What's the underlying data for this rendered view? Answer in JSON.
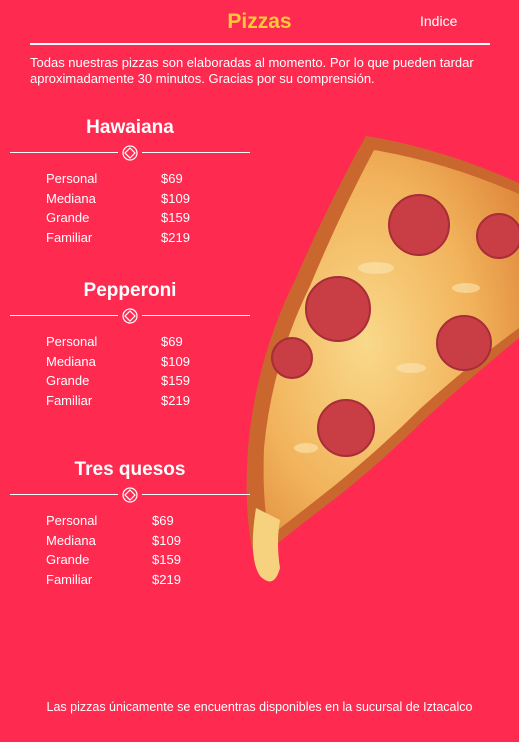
{
  "header": {
    "title": "Pizzas",
    "indice_link": "Indice"
  },
  "intro": "Todas nuestras pizzas son elaboradas al momento. Por lo que pueden tardar aproximadamente 30 minutos. Gracias por su comprensión.",
  "menus": [
    {
      "name": "Hawaiana",
      "prices": [
        {
          "size": "Personal",
          "price": "$69"
        },
        {
          "size": "Mediana",
          "price": "$109"
        },
        {
          "size": "Grande",
          "price": "$159"
        },
        {
          "size": "Familiar",
          "price": "$219"
        }
      ]
    },
    {
      "name": "Pepperoni",
      "prices": [
        {
          "size": "Personal",
          "price": "$69"
        },
        {
          "size": "Mediana",
          "price": "$109"
        },
        {
          "size": "Grande",
          "price": "$159"
        },
        {
          "size": "Familiar",
          "price": "$219"
        }
      ]
    },
    {
      "name": "Tres quesos",
      "prices": [
        {
          "size": "Personal",
          "price": "$69"
        },
        {
          "size": "Mediana",
          "price": "$109"
        },
        {
          "size": "Grande",
          "price": "$159"
        },
        {
          "size": "Familiar",
          "price": "$219"
        }
      ]
    }
  ],
  "footer": "Las pizzas únicamente se encuentras disponibles en la sucursal de Iztacalco",
  "colors": {
    "background": "#ff2a50",
    "title": "#ffc83a",
    "text": "#ffffff"
  },
  "icons": {
    "divider": "ornament-diamond-icon",
    "illustration": "pizza-slice-illustration"
  }
}
